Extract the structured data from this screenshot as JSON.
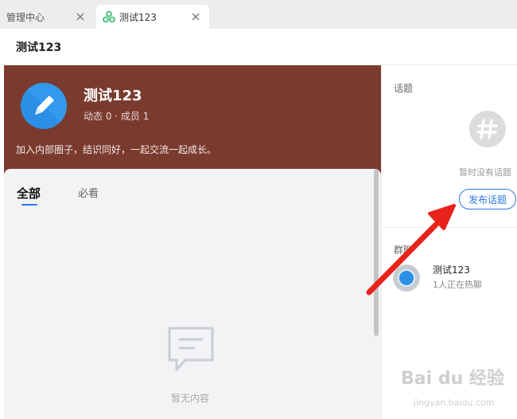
{
  "tabs": [
    {
      "label": "管理中心",
      "active": false
    },
    {
      "label": "测试123",
      "active": true
    }
  ],
  "page_title": "测试123",
  "hero": {
    "name": "测试123",
    "stats": "动态 0 · 成员 1",
    "description": "加入内部圈子，结识同好，一起交流一起成长。",
    "background_color": "#7a3b2e"
  },
  "feed_tabs": [
    {
      "label": "全部",
      "active": true
    },
    {
      "label": "必看",
      "active": false
    }
  ],
  "feed_empty_text": "暂无内容",
  "topics": {
    "section_title": "话题",
    "empty_text": "暂时没有话题",
    "publish_label": "发布话题"
  },
  "group_chat": {
    "section_title": "群聊",
    "items": [
      {
        "name": "测试123",
        "status": "1人正在热聊"
      }
    ]
  },
  "watermark": {
    "logo": "Bai du 经验",
    "url": "jingyan.baidu.com"
  },
  "colors": {
    "accent": "#2b78e4",
    "annotation_arrow": "#e8231c"
  }
}
